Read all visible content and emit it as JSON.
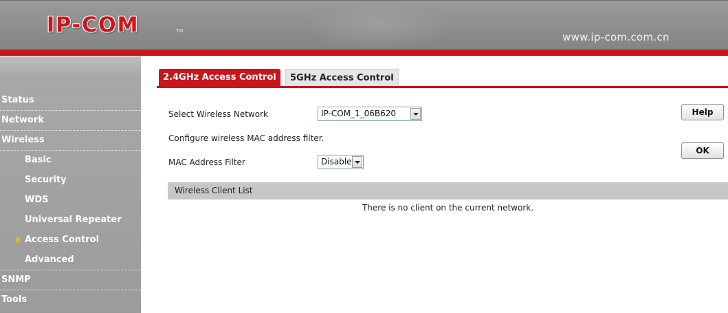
{
  "header": {
    "logo": "IP-COM",
    "logo_tm": "TM",
    "url": "www.ip-com.com.cn"
  },
  "sidebar": {
    "items": [
      {
        "label": "Status",
        "level": "top"
      },
      {
        "label": "Network",
        "level": "top"
      },
      {
        "label": "Wireless",
        "level": "top"
      },
      {
        "label": "Basic",
        "level": "sub"
      },
      {
        "label": "Security",
        "level": "sub"
      },
      {
        "label": "WDS",
        "level": "sub"
      },
      {
        "label": "Universal Repeater",
        "level": "sub"
      },
      {
        "label": "Access Control",
        "level": "sub",
        "active": true
      },
      {
        "label": "Advanced",
        "level": "sub"
      },
      {
        "label": "SNMP",
        "level": "top"
      },
      {
        "label": "Tools",
        "level": "top"
      }
    ]
  },
  "tabs": {
    "active": "2.4GHz Access Control",
    "inactive": "5GHz Access Control"
  },
  "form": {
    "network_label": "Select Wireless Network",
    "network_value": "IP-COM_1_06B620",
    "description": "Configure wireless MAC address filter.",
    "filter_label": "MAC Address Filter",
    "filter_value": "Disable"
  },
  "buttons": {
    "help": "Help",
    "ok": "OK"
  },
  "client_list": {
    "header": "Wireless Client List",
    "empty_message": "There is no client on the current network."
  },
  "colors": {
    "brand_red": "#c8151b",
    "sidebar_gray": "#9b9b9b",
    "active_arrow": "#f5c000"
  }
}
